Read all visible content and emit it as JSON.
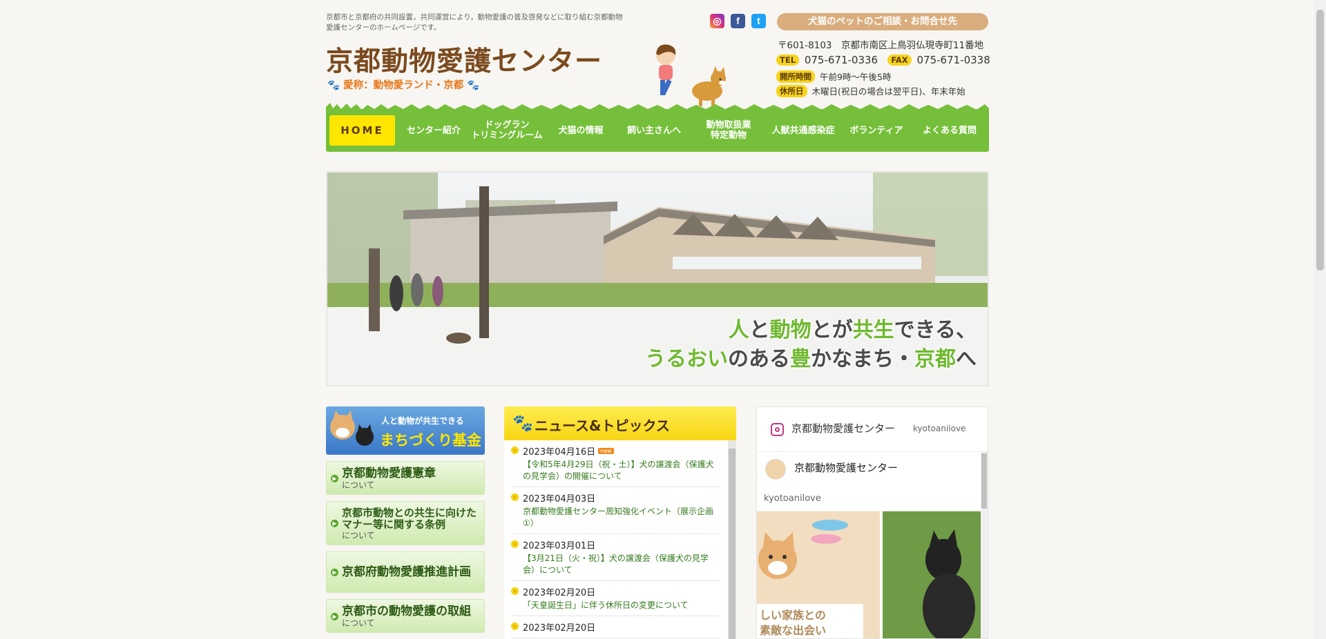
{
  "header": {
    "intro": "京都市と京都府の共同設置，共同運営により，動物愛護の普及啓発などに取り組む京都動物愛護センターのホームページです。",
    "logo": "京都動物愛護センター",
    "nickname": "愛称：動物愛ランド・京都",
    "consult_button": "犬猫のペットのご相談・お問合せ先",
    "address": "〒601-8103　京都市南区上鳥羽仏現寺町11番地",
    "tel_label": "TEL",
    "tel": "075-671-0336",
    "fax_label": "FAX",
    "fax": "075-671-0338",
    "hours_label": "開所時間",
    "hours": "午前9時～午後5時",
    "closed_label": "休所日",
    "closed": "木曜日(祝日の場合は翌平日)、年末年始",
    "social": [
      "instagram-icon",
      "facebook-icon",
      "twitter-icon"
    ]
  },
  "nav": {
    "items": [
      {
        "label": "HOME"
      },
      {
        "label": "センター紹介"
      },
      {
        "label": "ドッグラン\nトリミングルーム"
      },
      {
        "label": "犬猫の情報"
      },
      {
        "label": "飼い主さんへ"
      },
      {
        "label": "動物取扱業\n特定動物"
      },
      {
        "label": "人獣共通感染症"
      },
      {
        "label": "ボランティア"
      },
      {
        "label": "よくある質問"
      }
    ]
  },
  "hero": {
    "line1": [
      "人",
      "と",
      "動物",
      "とが",
      "共生",
      "できる、"
    ],
    "line2": [
      "うるおい",
      "のある",
      "豊",
      "かなまち・",
      "京都",
      "へ"
    ]
  },
  "sidebar": {
    "fund_line1": "人と動物が共生できる",
    "fund_line2": "まちづくり基金",
    "links": [
      {
        "main": "京都動物愛護憲章",
        "sub": "について"
      },
      {
        "main": "京都市動物との共生に向けたマナー等に関する条例",
        "sub": "について"
      },
      {
        "main": "京都府動物愛護推進計画",
        "sub": ""
      },
      {
        "main": "京都市の動物愛護の取組",
        "sub": "について"
      }
    ]
  },
  "news": {
    "title": "ニュース&トピックス",
    "new_badge": "new",
    "items": [
      {
        "date": "2023年04月16日",
        "text": "【令和5年4月29日（祝・土）】犬の譲渡会（保護犬の見学会）の開催について",
        "is_new": true
      },
      {
        "date": "2023年04月03日",
        "text": "京都動物愛護センター周知強化イベント（展示企画①）",
        "is_new": false
      },
      {
        "date": "2023年03月01日",
        "text": "【3月21日（火・祝）】犬の譲渡会（保護犬の見学会）について",
        "is_new": false
      },
      {
        "date": "2023年02月20日",
        "text": "「天皇誕生日」に伴う休所日の変更について",
        "is_new": false
      },
      {
        "date": "2023年02月20日",
        "text": "",
        "is_new": false
      }
    ]
  },
  "instagram": {
    "account_name": "京都動物愛護センター",
    "handle": "kyotoanilove",
    "profile_name": "京都動物愛護センター",
    "profile_handle": "kyotoanilove",
    "photo_caption": "しい家族との\n素敵な出会い"
  }
}
